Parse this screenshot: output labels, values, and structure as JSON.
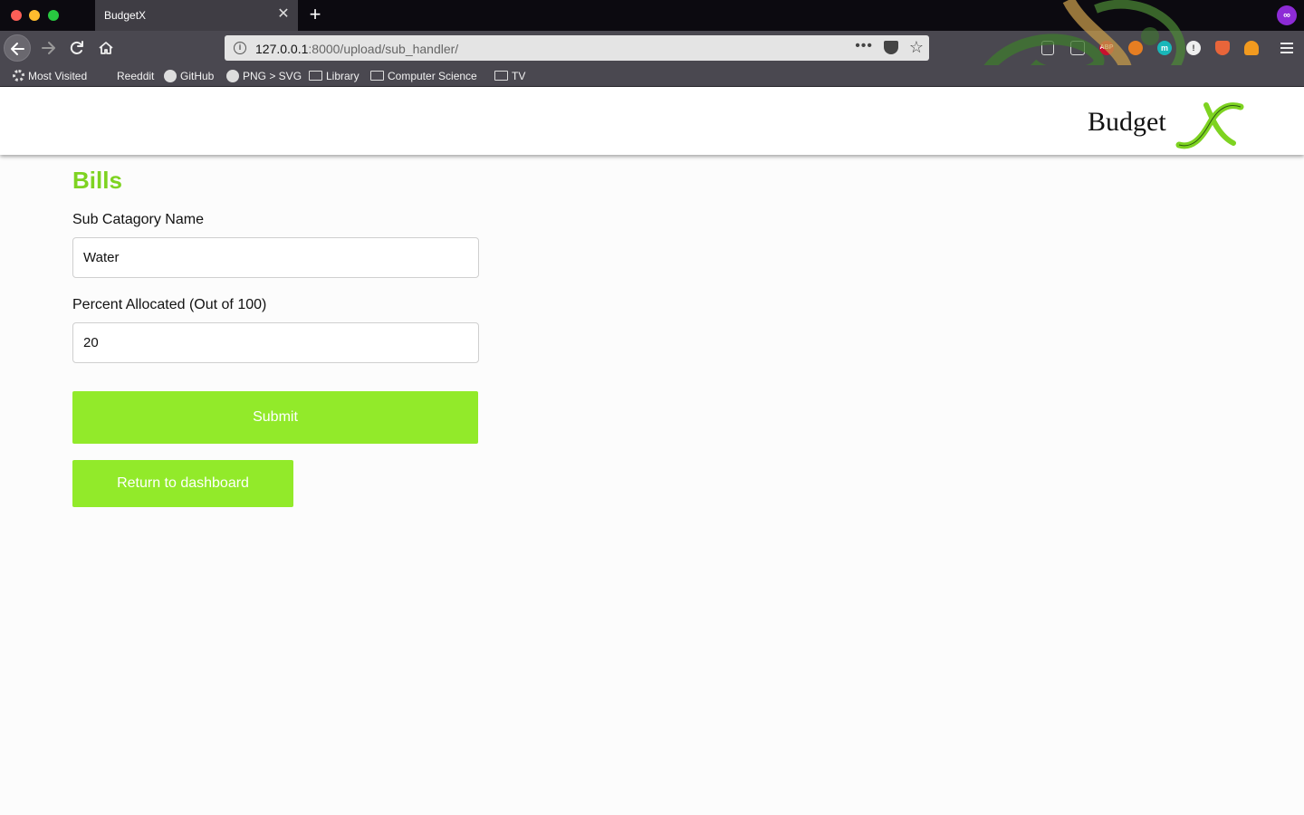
{
  "browser": {
    "tab_title": "BudgetX",
    "tab_close": "✕",
    "new_tab": "+",
    "private_badge": "∞",
    "url_host": "127.0.0.1",
    "url_rest": ":8000/upload/sub_handler/",
    "url_more": "•••",
    "bookmarks": [
      "Most Visited",
      "Reeddit",
      "GitHub",
      "PNG > SVG",
      "Library",
      "Computer Science",
      "TV"
    ],
    "extensions": [
      "ABP",
      "m"
    ]
  },
  "header": {
    "logo_text": "Budget",
    "brand_color": "#92ea2a"
  },
  "form": {
    "title": "Bills",
    "sub_category_label": "Sub Catagory Name",
    "sub_category_value": "Water",
    "percent_label": "Percent Allocated (Out of 100)",
    "percent_value": "20",
    "submit_label": "Submit",
    "return_label": "Return to dashboard"
  }
}
